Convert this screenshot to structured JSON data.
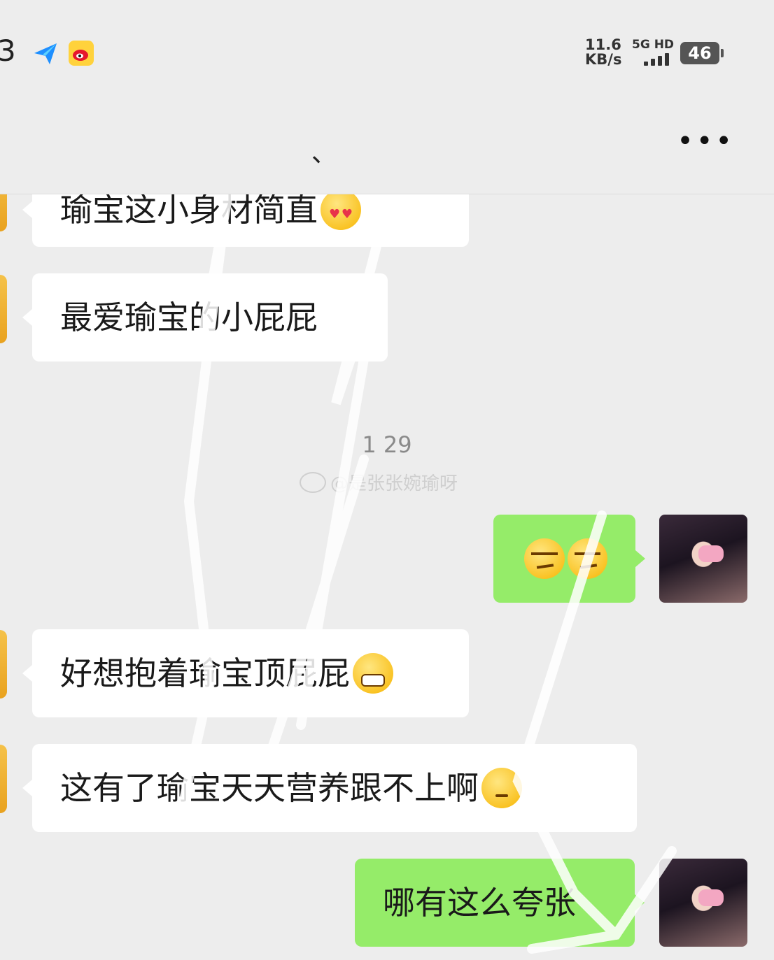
{
  "status_bar": {
    "time_fragment": "3",
    "net_speed_value": "11.6",
    "net_speed_unit": "KB/s",
    "network": "5G HD",
    "battery": "46"
  },
  "header": {
    "title": "、",
    "more": "•••"
  },
  "messages": [
    {
      "side": "in",
      "text": "瑜宝这小身材简直"
    },
    {
      "side": "in",
      "text": "最爱瑜宝的小屁屁"
    },
    {
      "side": "out",
      "text": ""
    },
    {
      "side": "in",
      "text": "好想抱着瑜宝顶屁屁"
    },
    {
      "side": "in",
      "text": "这有了瑜宝天天营养跟不上啊"
    },
    {
      "side": "out",
      "text": "哪有这么夸张"
    }
  ],
  "timestamp": "1 29",
  "watermark": "@是张张婉瑜呀",
  "icons": {
    "app1": "paper-plane-icon",
    "app2": "weibo-icon",
    "emoji_heart_eyes": "heart-eyes-emoji",
    "emoji_grin": "grin-emoji",
    "emoji_sad": "sad-emoji",
    "emoji_smirk": "smirk-emoji"
  },
  "colors": {
    "incoming_bubble": "#ffffff",
    "outgoing_bubble": "#95ec69",
    "background": "#ededed"
  }
}
